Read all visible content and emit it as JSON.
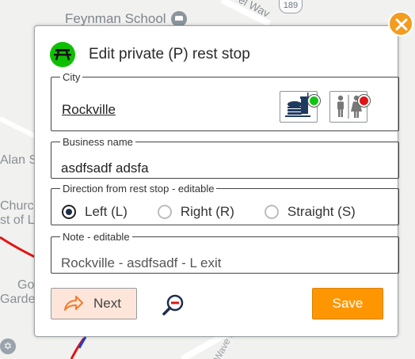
{
  "map": {
    "labels": {
      "school": "Feynman School",
      "road_top": "el Wav",
      "highway_shield": "189",
      "alan": "Alan S",
      "church": "Churc",
      "st_of": "st of L",
      "go": "Go",
      "garden": "Garden",
      "road_bottom": "Wave D"
    }
  },
  "dialog": {
    "title": "Edit private (P) rest stop",
    "icon": "picnic-table-icon",
    "icon_color": "#0cc000",
    "city": {
      "legend": "City",
      "value": "Rockville",
      "amenities": [
        {
          "name": "food-icon",
          "status": "available",
          "status_color": "#12c412"
        },
        {
          "name": "restroom-icon",
          "status": "unavailable",
          "status_color": "#e01414"
        }
      ]
    },
    "business": {
      "legend": "Business name",
      "value": "asdfsadf adsfa"
    },
    "direction": {
      "legend": "Direction from rest stop - editable",
      "options": [
        {
          "label": "Left (L)",
          "checked": true
        },
        {
          "label": "Right (R)",
          "checked": false
        },
        {
          "label": "Straight (S)",
          "checked": false
        }
      ]
    },
    "note": {
      "legend": "Note - editable",
      "value": "Rockville - asdfsadf - L exit"
    },
    "buttons": {
      "next": "Next",
      "save": "Save"
    },
    "colors": {
      "accent": "#fe9601",
      "next_bg": "#fde6d9"
    }
  }
}
